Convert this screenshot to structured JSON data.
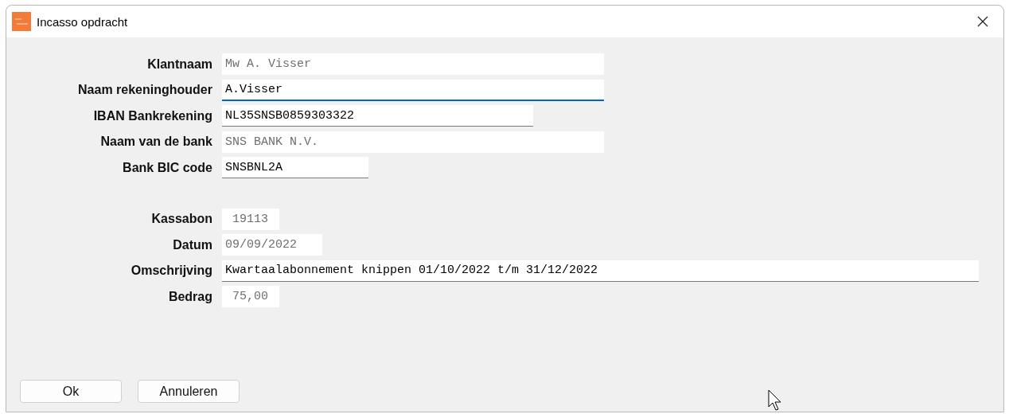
{
  "window": {
    "title": "Incasso opdracht"
  },
  "groups": [
    {
      "fields": [
        {
          "label": "Klantnaam",
          "value": "Mw A. Visser",
          "disabled": true,
          "focused": false
        },
        {
          "label": "Naam rekeninghouder",
          "value": "A.Visser",
          "disabled": false,
          "focused": true
        },
        {
          "label": "IBAN Bankrekening",
          "value": "NL35SNSB0859303322",
          "disabled": false,
          "focused": false
        },
        {
          "label": "Naam van de bank",
          "value": "SNS BANK N.V.",
          "disabled": true,
          "focused": false
        },
        {
          "label": "Bank BIC code",
          "value": "SNSBNL2A",
          "disabled": false,
          "focused": false
        }
      ]
    },
    {
      "fields": [
        {
          "label": "Kassabon",
          "value": " 19113",
          "disabled": true,
          "focused": false
        },
        {
          "label": "Datum",
          "value": "09/09/2022",
          "disabled": true,
          "focused": false
        },
        {
          "label": "Omschrijving",
          "value": "Kwartaalabonnement knippen 01/10/2022 t/m 31/12/2022",
          "disabled": false,
          "focused": false
        },
        {
          "label": "Bedrag",
          "value": " 75,00",
          "disabled": true,
          "focused": false
        }
      ]
    }
  ],
  "buttons": [
    "Ok",
    "Annuleren"
  ]
}
